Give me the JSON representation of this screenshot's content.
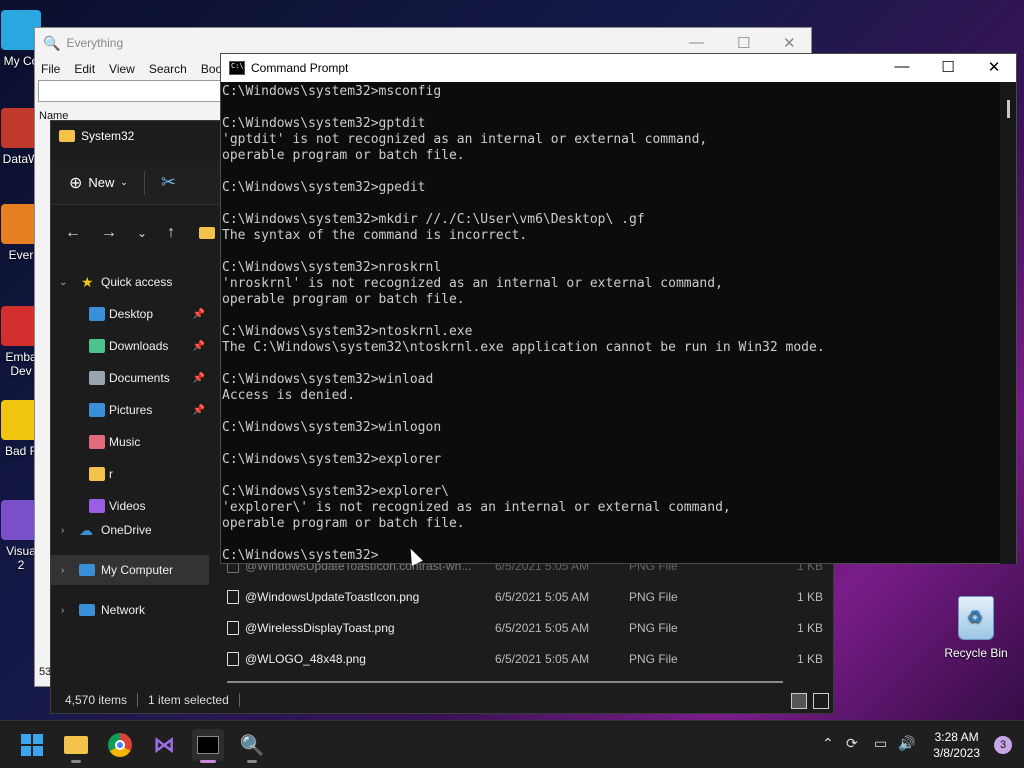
{
  "desktop": {
    "icons": [
      {
        "label": "My Co",
        "color": "#2aa7e0"
      },
      {
        "label": "DataW",
        "color": "#c0392b"
      },
      {
        "label": "Ever",
        "color": "#e67e22"
      },
      {
        "label": "Emba\nDev",
        "color": "#d32f2f"
      },
      {
        "label": "Bad F",
        "color": "#f1c40f"
      },
      {
        "label": "Visua\n2",
        "color": "#7b4fc9"
      }
    ],
    "recycle_bin_label": "Recycle Bin"
  },
  "everything": {
    "title": "Everything",
    "menu": [
      "File",
      "Edit",
      "View",
      "Search",
      "Book"
    ],
    "column_name": "Name",
    "count_fragment": "53"
  },
  "explorer": {
    "title": "System32",
    "toolbar": {
      "new_label": "New"
    },
    "sidebar": {
      "quick_access": "Quick access",
      "items": [
        {
          "label": "Desktop",
          "pinned": true,
          "color": "#3a8fd9"
        },
        {
          "label": "Downloads",
          "pinned": true,
          "color": "#4cc38a"
        },
        {
          "label": "Documents",
          "pinned": true,
          "color": "#9aa4b0"
        },
        {
          "label": "Pictures",
          "pinned": true,
          "color": "#3a8fd9"
        },
        {
          "label": "Music",
          "pinned": false,
          "color": "#e36a7a"
        },
        {
          "label": "r",
          "pinned": false,
          "color": "#f2c24b"
        },
        {
          "label": "Videos",
          "pinned": false,
          "color": "#9b5de5"
        }
      ],
      "onedrive": "OneDrive",
      "my_computer": "My Computer",
      "network": "Network"
    },
    "files": [
      {
        "name": "@WindowsUpdateToastIcon.contrast-wh...",
        "date": "6/5/2021 5:05 AM",
        "type": "PNG File",
        "size": "1 KB"
      },
      {
        "name": "@WindowsUpdateToastIcon.png",
        "date": "6/5/2021 5:05 AM",
        "type": "PNG File",
        "size": "1 KB"
      },
      {
        "name": "@WirelessDisplayToast.png",
        "date": "6/5/2021 5:05 AM",
        "type": "PNG File",
        "size": "1 KB"
      },
      {
        "name": "@WLOGO_48x48.png",
        "date": "6/5/2021 5:05 AM",
        "type": "PNG File",
        "size": "1 KB"
      }
    ],
    "status": {
      "items": "4,570 items",
      "selected": "1 item selected"
    }
  },
  "cmd": {
    "title": "Command Prompt",
    "lines": [
      "C:\\Windows\\system32>msconfig",
      "",
      "C:\\Windows\\system32>gptdit",
      "'gptdit' is not recognized as an internal or external command,",
      "operable program or batch file.",
      "",
      "C:\\Windows\\system32>gpedit",
      "",
      "C:\\Windows\\system32>mkdir //./C:\\User\\vm6\\Desktop\\ .gf",
      "The syntax of the command is incorrect.",
      "",
      "C:\\Windows\\system32>nroskrnl",
      "'nroskrnl' is not recognized as an internal or external command,",
      "operable program or batch file.",
      "",
      "C:\\Windows\\system32>ntoskrnl.exe",
      "The C:\\Windows\\system32\\ntoskrnl.exe application cannot be run in Win32 mode.",
      "",
      "C:\\Windows\\system32>winload",
      "Access is denied.",
      "",
      "C:\\Windows\\system32>winlogon",
      "",
      "C:\\Windows\\system32>explorer",
      "",
      "C:\\Windows\\system32>explorer\\",
      "'explorer\\' is not recognized as an internal or external command,",
      "operable program or batch file.",
      "",
      "C:\\Windows\\system32>"
    ]
  },
  "taskbar": {
    "clock_time": "3:28 AM",
    "clock_date": "3/8/2023",
    "notification_count": "3"
  }
}
